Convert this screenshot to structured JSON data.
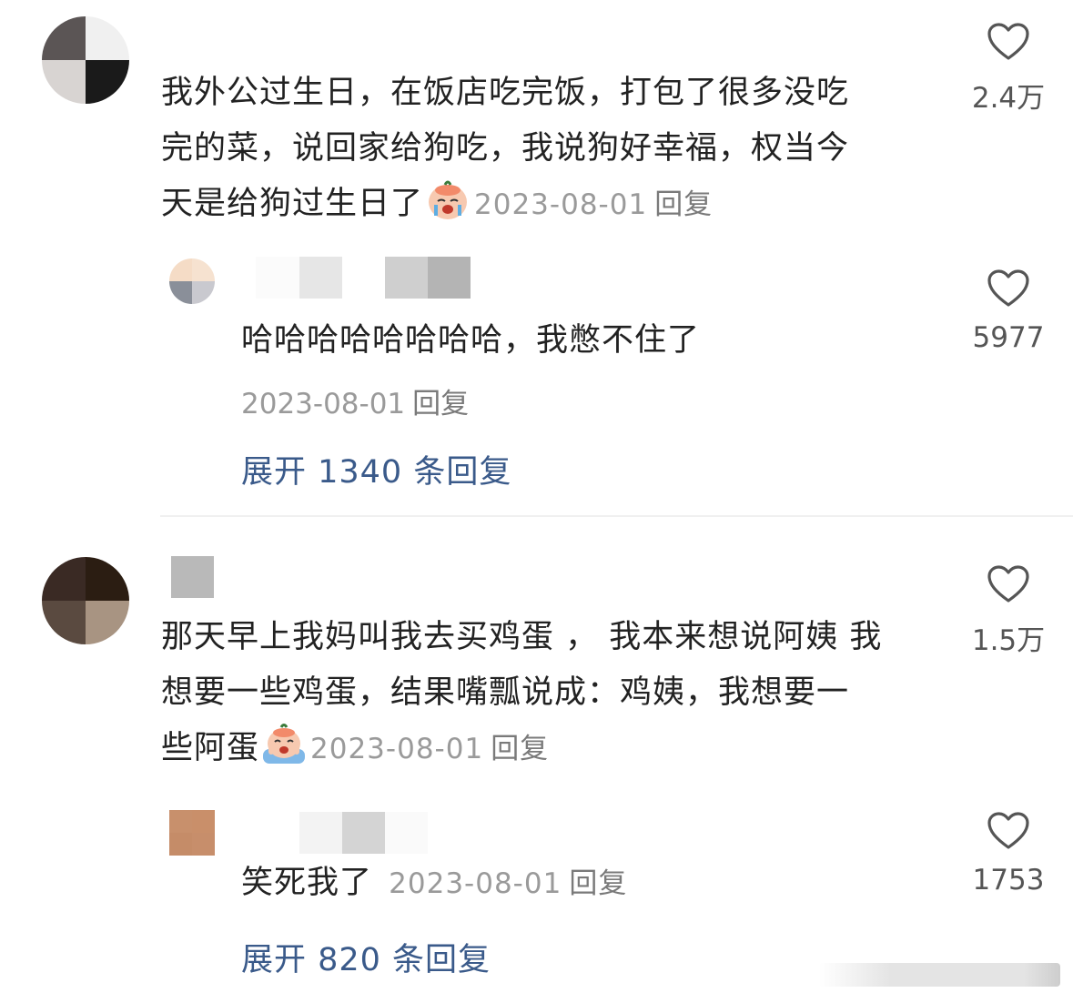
{
  "comments": [
    {
      "text_lines": [
        "我外公过生日，在饭店吃完饭，打包了很多没吃",
        "完的菜，说回家给狗吃，我说狗好幸福，权当今",
        "天是给狗过生日了"
      ],
      "emoji": "crying-face-emoji",
      "date": "2023-08-01",
      "reply_label": "回复",
      "likes": "2.4万",
      "reply": {
        "text": "哈哈哈哈哈哈哈哈，我憋不住了",
        "date": "2023-08-01",
        "reply_label": "回复",
        "likes": "5977"
      },
      "expand_label": "展开 1340 条回复"
    },
    {
      "text_lines": [
        "那天早上我妈叫我去买鸡蛋 ， 我本来想说阿姨 我",
        "想要一些鸡蛋，结果嘴瓢说成：鸡姨，我想要一",
        "些阿蛋"
      ],
      "emoji": "crying-in-water-emoji",
      "date": "2023-08-01",
      "reply_label": "回复",
      "likes": "1.5万",
      "reply": {
        "text": "笑死我了",
        "date": "2023-08-01",
        "reply_label": "回复",
        "likes": "1753"
      },
      "expand_label": "展开 820 条回复"
    }
  ],
  "icons": {
    "like": "heart-outline-icon"
  },
  "colors": {
    "text": "#222222",
    "meta": "#9a9a9a",
    "expand_link": "#3a5a8a",
    "like_count": "#555555"
  }
}
